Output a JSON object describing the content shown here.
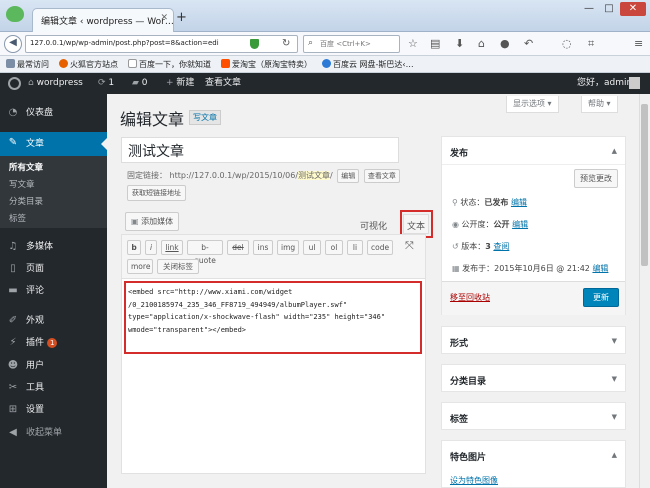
{
  "browser": {
    "tab_title": "编辑文章 ‹ wordpress — Wor…",
    "new_tab": "+",
    "url": "127.0.0.1/wp/wp-admin/post.php?post=8&action=edi",
    "search_placeholder": "百度 <Ctrl+K>",
    "bookmarks": [
      "最常访问",
      "火狐官方站点",
      "百度一下，你就知道",
      "爱淘宝（原淘宝特卖）",
      "百度云 网盘-斯巴达‹…"
    ]
  },
  "adminbar": {
    "site_name": "wordpress",
    "updates_count": "1",
    "comments_count": "0",
    "new_label": "新建",
    "view_label": "查看文章",
    "greeting": "您好，admin"
  },
  "sidebar": {
    "dashboard": "仪表盘",
    "posts": "文章",
    "submenu": [
      "所有文章",
      "写文章",
      "分类目录",
      "标签"
    ],
    "media": "多媒体",
    "pages": "页面",
    "comments": "评论",
    "appearance": "外观",
    "plugins": "插件",
    "plugins_badge": "1",
    "users": "用户",
    "tools": "工具",
    "settings": "设置",
    "collapse": "收起菜单"
  },
  "main": {
    "page_title": "编辑文章",
    "write_post": "写文章",
    "screen_options": "显示选项 ▾",
    "help": "帮助 ▾",
    "post_title": "测试文章",
    "permalink_label": "固定链接：",
    "permalink_url": "http://127.0.0.1/wp/2015/10/06/",
    "permalink_slug": "测试文章",
    "permalink_end": "/",
    "edit_btn": "编辑",
    "view_btn": "查看文章",
    "shortlink_btn": "获取短链接地址",
    "add_media": "添加媒体",
    "tab_visual": "可视化",
    "tab_text": "文本",
    "quicktags": [
      "b",
      "i",
      "link",
      "b-quote",
      "del",
      "ins",
      "img",
      "ul",
      "ol",
      "li",
      "code"
    ],
    "quicktags_row2": [
      "more",
      "关闭标签"
    ],
    "editor_content": "<embed src=\"http://www.xiami.com/widget\n/0_2100185974_235_346_FF8719_494949/albumPlayer.swf\"\ntype=\"application/x-shockwave-flash\" width=\"235\" height=\"346\"\nwmode=\"transparent\"></embed>"
  },
  "publish_box": {
    "title": "发布",
    "preview_btn": "预览更改",
    "status_label": "状态：",
    "status_value": "已发布",
    "visibility_label": "公开度：",
    "visibility_value": "公开",
    "revisions_label": "版本：",
    "revisions_value": "3",
    "revisions_link": "查阅",
    "published_label": "发布于：",
    "published_value": "2015年10月6日 @ 21:42",
    "edit_link": "编辑",
    "trash": "移至回收站",
    "update_btn": "更新"
  },
  "side_boxes": {
    "format": "形式",
    "categories": "分类目录",
    "tags": "标签",
    "featured_image": "特色图片",
    "set_featured": "设为特色图像"
  },
  "colors": {
    "admin_bar": "#23282d",
    "active_menu": "#0073aa",
    "primary_button": "#0085ba",
    "highlight_box": "#d42b2b"
  }
}
